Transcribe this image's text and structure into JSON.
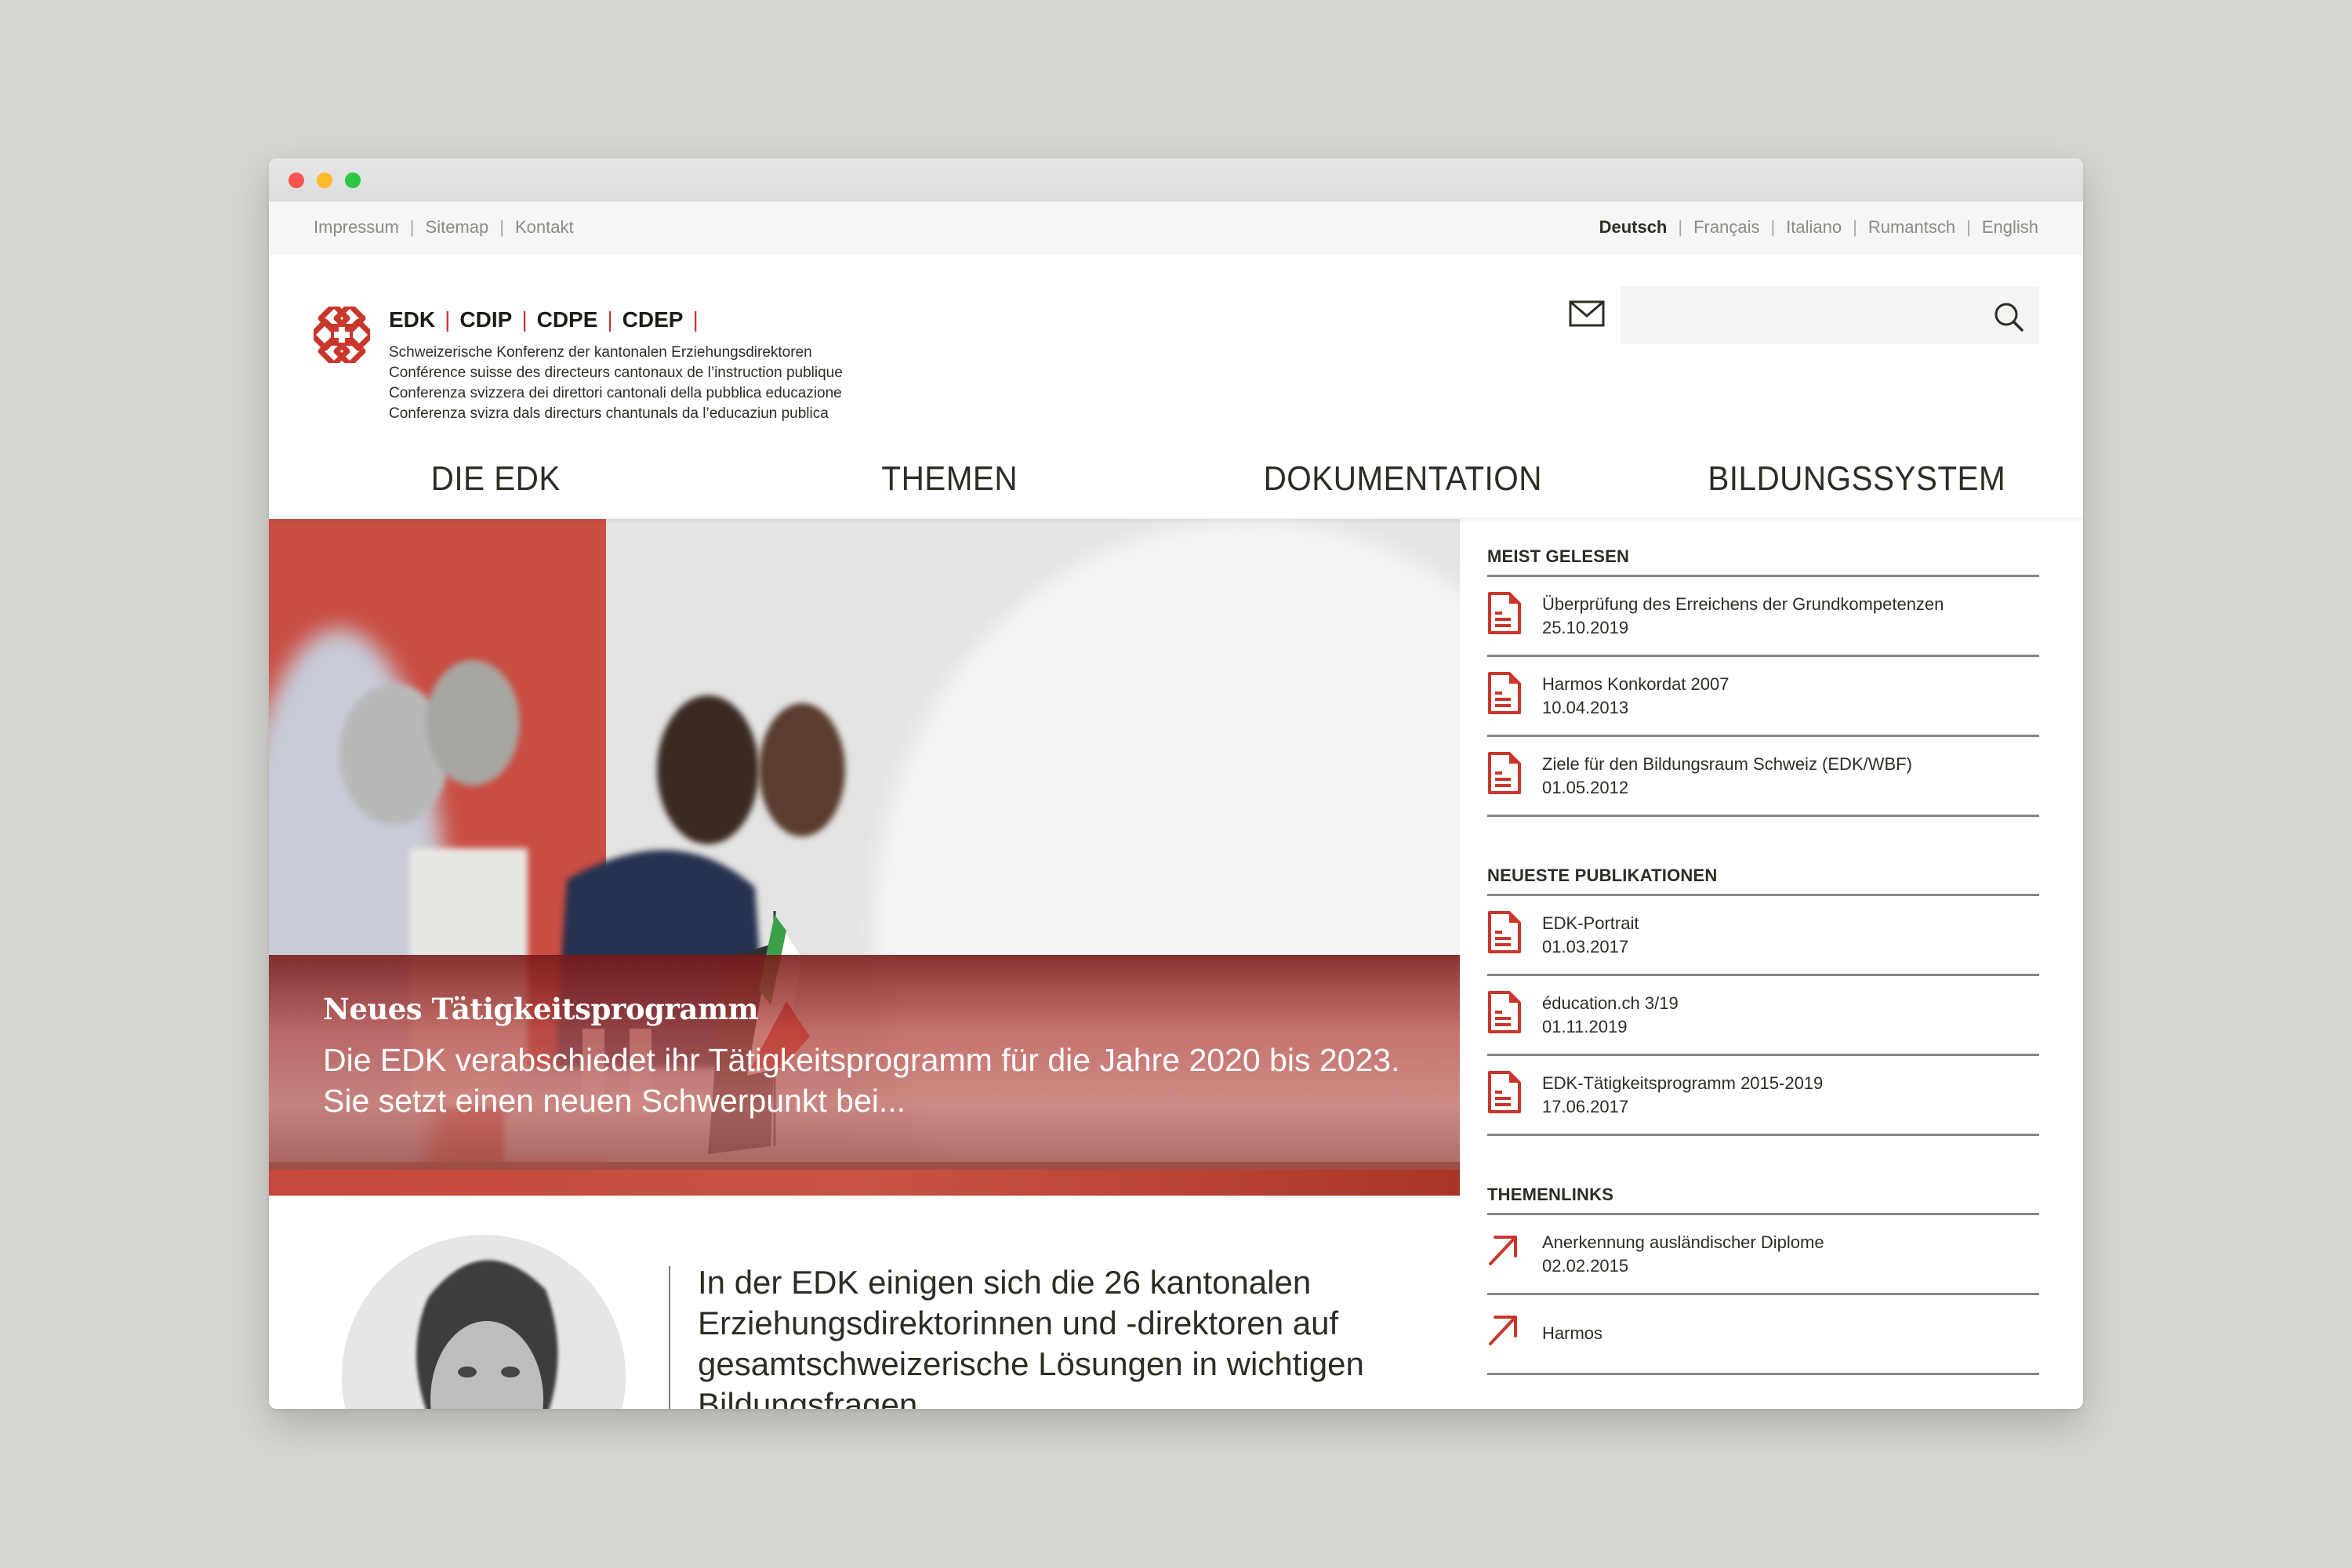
{
  "window": {
    "traffic_lights": [
      "close",
      "minimize",
      "zoom"
    ]
  },
  "utility_bar": {
    "links": [
      "Impressum",
      "Sitemap",
      "Kontakt"
    ],
    "languages": [
      {
        "label": "Deutsch",
        "active": true
      },
      {
        "label": "Français",
        "active": false
      },
      {
        "label": "Italiano",
        "active": false
      },
      {
        "label": "Rumantsch",
        "active": false
      },
      {
        "label": "English",
        "active": false
      }
    ]
  },
  "header": {
    "logo_icon": "edk-cross-logo-icon",
    "abbreviations": [
      "EDK",
      "CDIP",
      "CDPE",
      "CDEP"
    ],
    "names": [
      "Schweizerische Konferenz der kantonalen Erziehungsdirektoren",
      "Conférence suisse des directeurs cantonaux de l’instruction publique",
      "Conferenza svizzera dei direttori cantonali della pubblica educazione",
      "Conferenza svizra dals directurs chantunals da l’educaziun publica"
    ],
    "mail_icon": "envelope-icon",
    "search": {
      "value": "",
      "placeholder": "",
      "icon": "search-icon"
    }
  },
  "nav": {
    "items": [
      "DIE EDK",
      "THEMEN",
      "DOKUMENTATION",
      "BILDUNGSSYSTEM"
    ]
  },
  "hero": {
    "title": "Neues Tätigkeitsprogramm",
    "text": "Die EDK verabschiedet ihr Tätigkeitsprogramm für die Jahre 2020 bis 2023. Sie setzt einen neuen Schwerpunkt bei..."
  },
  "intro": {
    "text": "In der EDK einigen sich die 26 kantonalen Erziehungsdirektorinnen und -direktoren auf gesamtschweizerische Lösungen in wichtigen Bildungsfragen."
  },
  "sidebar": {
    "accent_color": "#c9362b",
    "sections": [
      {
        "heading": "MEIST GELESEN",
        "icon": "document-icon",
        "items": [
          {
            "title": "Überprüfung des Erreichens der Grundkompetenzen",
            "date": "25.10.2019"
          },
          {
            "title": "Harmos Konkordat 2007",
            "date": "10.04.2013"
          },
          {
            "title": "Ziele für den Bildungsraum Schweiz (EDK/WBF)",
            "date": "01.05.2012"
          }
        ]
      },
      {
        "heading": "NEUESTE PUBLIKATIONEN",
        "icon": "document-icon",
        "items": [
          {
            "title": "EDK-Portrait",
            "date": "01.03.2017"
          },
          {
            "title": "éducation.ch 3/19",
            "date": "01.11.2019"
          },
          {
            "title": "EDK-Tätigkeitsprogramm 2015-2019",
            "date": "17.06.2017"
          }
        ]
      },
      {
        "heading": "THEMENLINKS",
        "icon": "arrow-up-right-icon",
        "items": [
          {
            "title": "Anerkennung ausländischer Diplome",
            "date": "02.02.2015"
          },
          {
            "title": "Harmos",
            "date": ""
          }
        ]
      }
    ]
  }
}
